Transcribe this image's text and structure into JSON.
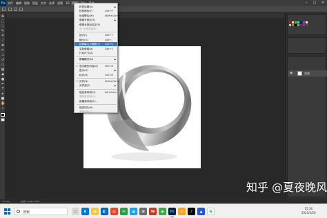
{
  "app": {
    "logo": "Ps",
    "menubar": [
      "文件",
      "编辑",
      "图像",
      "图层",
      "文字",
      "选择",
      "滤镜",
      "3D",
      "视图",
      "窗口",
      "帮助"
    ],
    "active_menu_index": 8
  },
  "view_menu": {
    "items": [
      {
        "label": "校样设置(U)",
        "shortcut": "",
        "submenu": true,
        "disabled": false
      },
      {
        "label": "校样颜色(Y)",
        "shortcut": "Ctrl+Y",
        "disabled": false
      },
      {
        "label": "色域警告(W)",
        "shortcut": "Shift+Ctrl+Y",
        "disabled": false
      },
      {
        "label": "像素长宽比(S)",
        "shortcut": "",
        "submenu": true,
        "disabled": false
      },
      {
        "label": "像素长宽比校正(P)",
        "shortcut": "",
        "disabled": false
      },
      {
        "label": "32 位预览选项...",
        "shortcut": "",
        "disabled": true
      },
      {
        "label": "放大(I)",
        "shortcut": "Ctrl++",
        "disabled": false
      },
      {
        "label": "缩小(O)",
        "shortcut": "Ctrl+-",
        "disabled": false
      },
      {
        "label": "按屏幕大小缩放(F)",
        "shortcut": "Ctrl+0",
        "disabled": false,
        "highlighted": true
      },
      {
        "label": "实际像素(A)",
        "shortcut": "Ctrl+1",
        "disabled": false
      },
      {
        "label": "打印尺寸(Z)",
        "shortcut": "",
        "disabled": false
      },
      {
        "label": "屏幕模式(M)",
        "shortcut": "",
        "submenu": true,
        "disabled": false
      },
      {
        "label": "显示额外内容(X)",
        "shortcut": "Ctrl+H",
        "disabled": false,
        "checked": true
      },
      {
        "label": "显示(H)",
        "shortcut": "",
        "submenu": true,
        "disabled": false
      },
      {
        "label": "标尺(R)",
        "shortcut": "Ctrl+R",
        "disabled": false
      },
      {
        "label": "对齐(N)",
        "shortcut": "Shift+Ctrl+;",
        "disabled": false,
        "checked": true
      },
      {
        "label": "对齐到(T)",
        "shortcut": "",
        "submenu": true,
        "disabled": false
      },
      {
        "label": "锁定参考线(G)",
        "shortcut": "Alt+Ctrl+;",
        "disabled": false
      },
      {
        "label": "清除参考线(D)",
        "shortcut": "",
        "disabled": true
      },
      {
        "label": "新建参考线(E)...",
        "shortcut": "",
        "disabled": false
      },
      {
        "label": "锁定切片(K)",
        "shortcut": "",
        "disabled": false
      },
      {
        "label": "清除切片(C)",
        "shortcut": "",
        "disabled": true
      }
    ]
  },
  "layers_panel": {
    "layer_name": "背景"
  },
  "statusbar": {
    "zoom": "33.33%",
    "doc_info": "文档:1.43M/1.43M"
  },
  "taskbar": {
    "search_placeholder": "搜索",
    "time": "15:36",
    "date": "2021/5/20"
  },
  "watermark": "知乎 @夏夜晚风",
  "colors": {
    "menu_highlight": "#3c76c4",
    "canvas_bg": "#ffffff",
    "workspace": "#282828"
  }
}
